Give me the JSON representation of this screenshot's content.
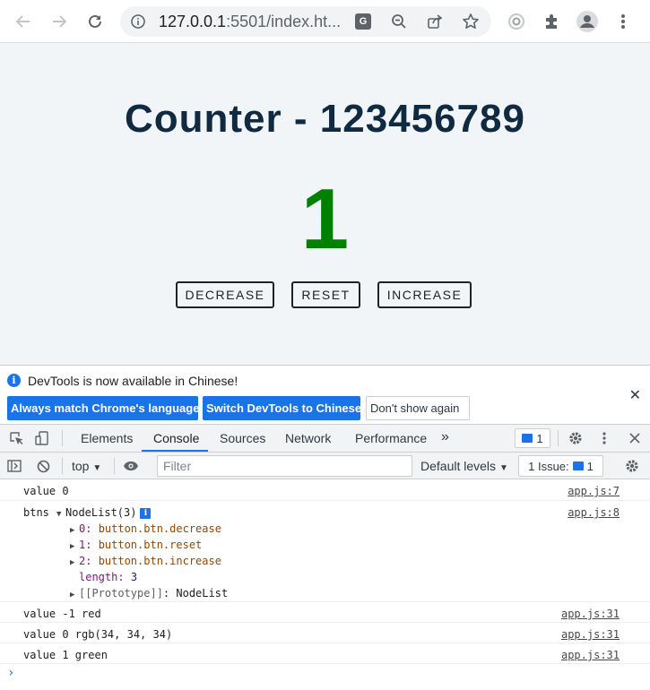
{
  "browser": {
    "url_host": "127.0.0.1",
    "url_rest": ":5501/index.ht..."
  },
  "page": {
    "title": "Counter - 123456789",
    "counter_value": "1",
    "counter_color": "#008000",
    "buttons": {
      "decrease": "DECREASE",
      "reset": "RESET",
      "increase": "INCREASE"
    }
  },
  "infobar": {
    "message": "DevTools is now available in Chinese!",
    "match_language": "Always match Chrome's language",
    "switch_chinese": "Switch DevTools to Chinese",
    "dont_show": "Don't show again"
  },
  "devtools": {
    "tabs": [
      "Elements",
      "Console",
      "Sources",
      "Network",
      "Performance"
    ],
    "active_tab": "Console",
    "more_tabs": "»",
    "message_count": "1",
    "accent": "#1a73e8"
  },
  "console_bar": {
    "context": "top",
    "filter_placeholder": "Filter",
    "levels": "Default levels",
    "issues_label": "1 Issue:",
    "issues_count": "1"
  },
  "console": {
    "rows": [
      {
        "text": "value 0",
        "source": "app.js:7"
      },
      {
        "text": "btns",
        "source": "app.js:8"
      },
      {
        "text": "value -1 red",
        "source": "app.js:31"
      },
      {
        "text": "value 0 rgb(34, 34, 34)",
        "source": "app.js:31"
      },
      {
        "text": "value 1 green",
        "source": "app.js:31"
      }
    ],
    "nodelist": {
      "summary": "NodeList(3)",
      "items": [
        {
          "key": "0",
          "value": "button.btn.decrease"
        },
        {
          "key": "1",
          "value": "button.btn.reset"
        },
        {
          "key": "2",
          "value": "button.btn.increase"
        }
      ],
      "length_key": "length",
      "length_value": "3",
      "prototype_key": "[[Prototype]]",
      "prototype_value": "NodeList"
    },
    "prompt": "›"
  }
}
